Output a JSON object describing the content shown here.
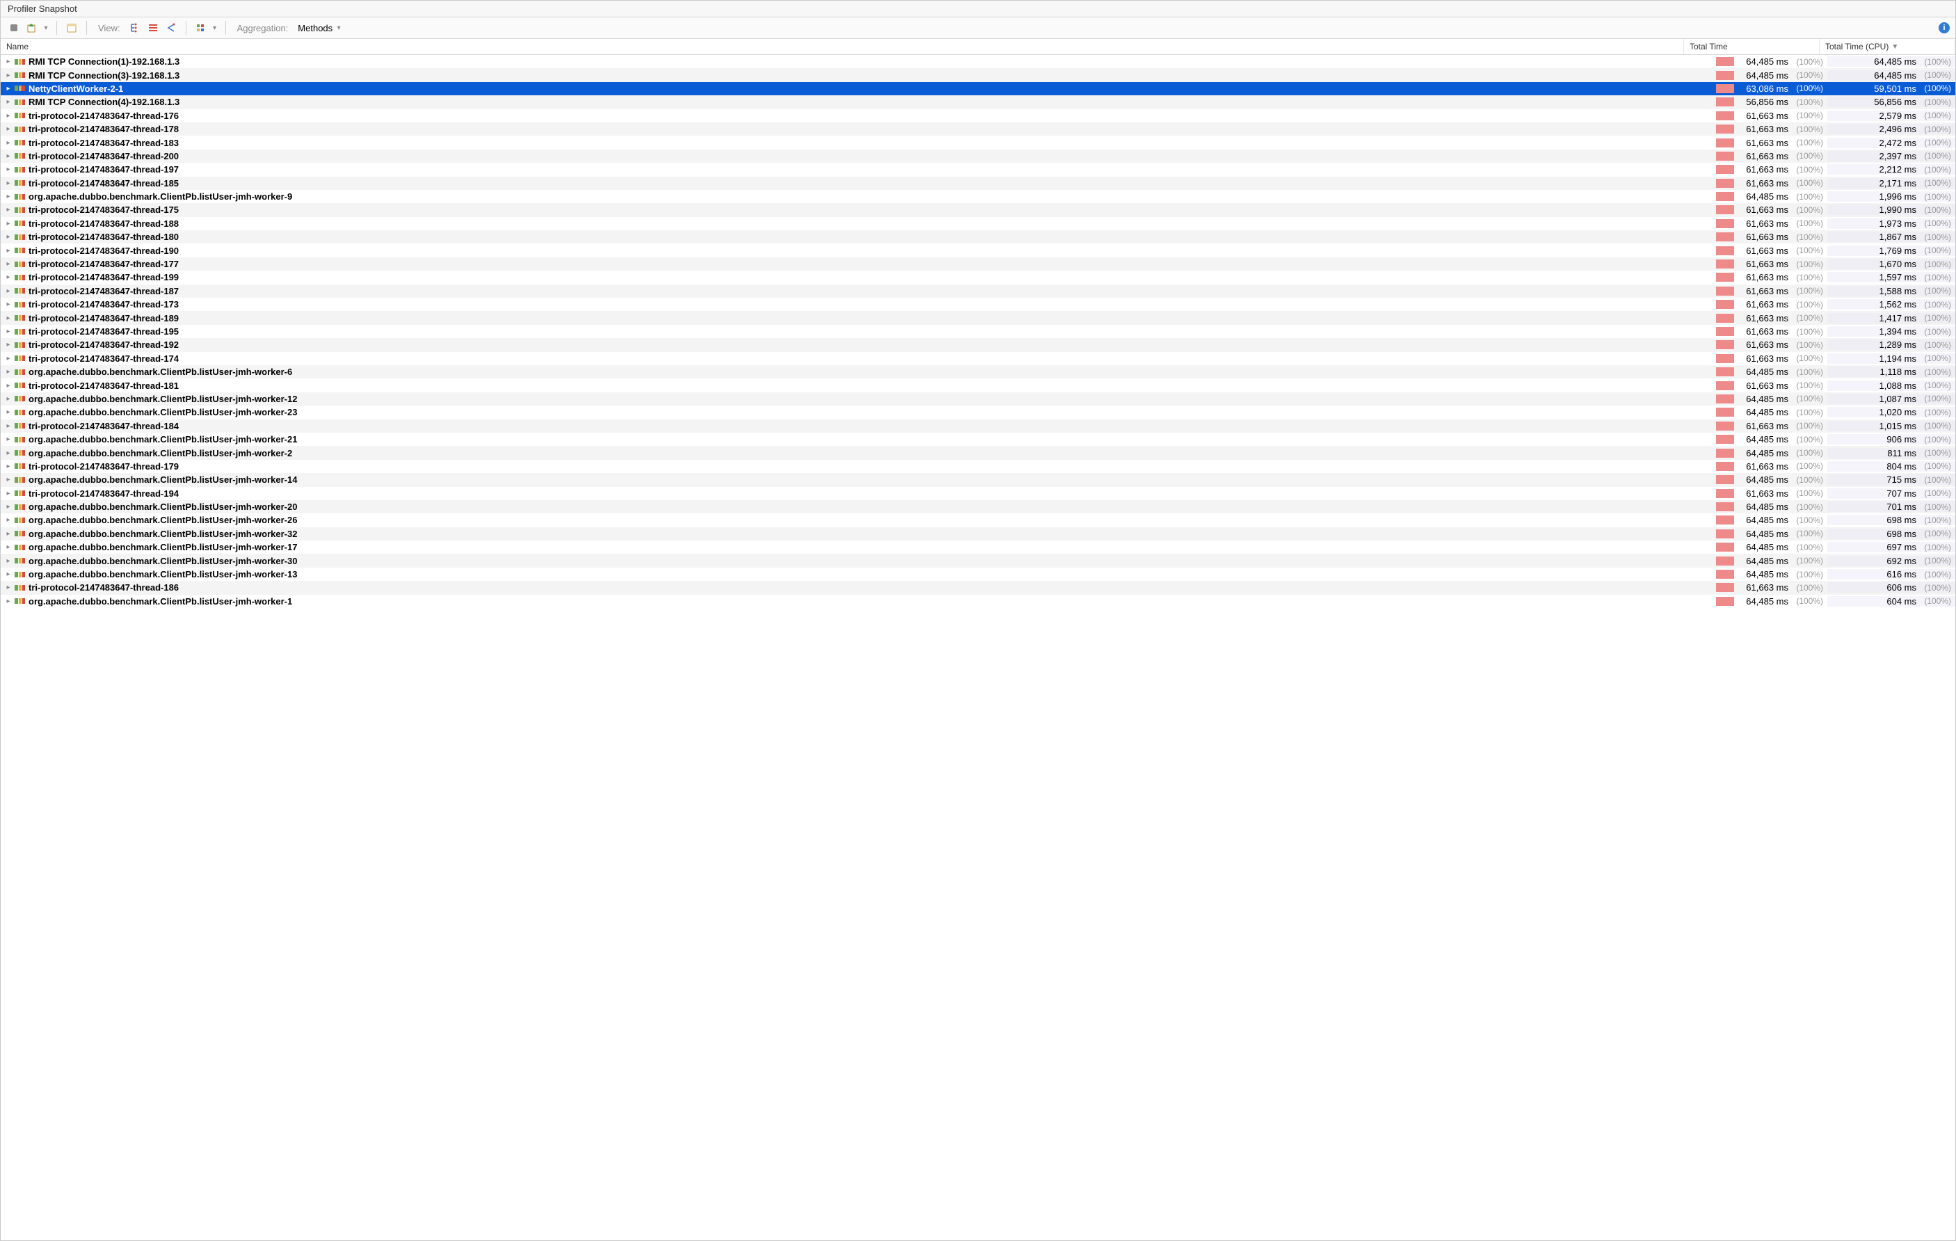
{
  "title": "Profiler Snapshot",
  "toolbar": {
    "view_label": "View:",
    "aggregation_label": "Aggregation:",
    "aggregation_value": "Methods"
  },
  "columns": {
    "name": "Name",
    "total_time": "Total Time",
    "total_time_cpu": "Total Time (CPU)"
  },
  "rows": [
    {
      "name": "RMI TCP Connection(1)-192.168.1.3",
      "tt": "64,485 ms",
      "ttp": "(100%)",
      "cpu": "64,485 ms",
      "cpup": "(100%)",
      "sel": false,
      "icon": "run"
    },
    {
      "name": "RMI TCP Connection(3)-192.168.1.3",
      "tt": "64,485 ms",
      "ttp": "(100%)",
      "cpu": "64,485 ms",
      "cpup": "(100%)",
      "sel": false,
      "icon": "run"
    },
    {
      "name": "NettyClientWorker-2-1",
      "tt": "63,086 ms",
      "ttp": "(100%)",
      "cpu": "59,501 ms",
      "cpup": "(100%)",
      "sel": true,
      "icon": "run"
    },
    {
      "name": "RMI TCP Connection(4)-192.168.1.3",
      "tt": "56,856 ms",
      "ttp": "(100%)",
      "cpu": "56,856 ms",
      "cpup": "(100%)",
      "sel": false,
      "icon": "run"
    },
    {
      "name": "tri-protocol-2147483647-thread-176",
      "tt": "61,663 ms",
      "ttp": "(100%)",
      "cpu": "2,579 ms",
      "cpup": "(100%)",
      "sel": false,
      "icon": "wait"
    },
    {
      "name": "tri-protocol-2147483647-thread-178",
      "tt": "61,663 ms",
      "ttp": "(100%)",
      "cpu": "2,496 ms",
      "cpup": "(100%)",
      "sel": false,
      "icon": "wait"
    },
    {
      "name": "tri-protocol-2147483647-thread-183",
      "tt": "61,663 ms",
      "ttp": "(100%)",
      "cpu": "2,472 ms",
      "cpup": "(100%)",
      "sel": false,
      "icon": "wait"
    },
    {
      "name": "tri-protocol-2147483647-thread-200",
      "tt": "61,663 ms",
      "ttp": "(100%)",
      "cpu": "2,397 ms",
      "cpup": "(100%)",
      "sel": false,
      "icon": "wait"
    },
    {
      "name": "tri-protocol-2147483647-thread-197",
      "tt": "61,663 ms",
      "ttp": "(100%)",
      "cpu": "2,212 ms",
      "cpup": "(100%)",
      "sel": false,
      "icon": "wait"
    },
    {
      "name": "tri-protocol-2147483647-thread-185",
      "tt": "61,663 ms",
      "ttp": "(100%)",
      "cpu": "2,171 ms",
      "cpup": "(100%)",
      "sel": false,
      "icon": "wait"
    },
    {
      "name": "org.apache.dubbo.benchmark.ClientPb.listUser-jmh-worker-9",
      "tt": "64,485 ms",
      "ttp": "(100%)",
      "cpu": "1,996 ms",
      "cpup": "(100%)",
      "sel": false,
      "icon": "wait"
    },
    {
      "name": "tri-protocol-2147483647-thread-175",
      "tt": "61,663 ms",
      "ttp": "(100%)",
      "cpu": "1,990 ms",
      "cpup": "(100%)",
      "sel": false,
      "icon": "wait"
    },
    {
      "name": "tri-protocol-2147483647-thread-188",
      "tt": "61,663 ms",
      "ttp": "(100%)",
      "cpu": "1,973 ms",
      "cpup": "(100%)",
      "sel": false,
      "icon": "wait"
    },
    {
      "name": "tri-protocol-2147483647-thread-180",
      "tt": "61,663 ms",
      "ttp": "(100%)",
      "cpu": "1,867 ms",
      "cpup": "(100%)",
      "sel": false,
      "icon": "wait"
    },
    {
      "name": "tri-protocol-2147483647-thread-190",
      "tt": "61,663 ms",
      "ttp": "(100%)",
      "cpu": "1,769 ms",
      "cpup": "(100%)",
      "sel": false,
      "icon": "wait"
    },
    {
      "name": "tri-protocol-2147483647-thread-177",
      "tt": "61,663 ms",
      "ttp": "(100%)",
      "cpu": "1,670 ms",
      "cpup": "(100%)",
      "sel": false,
      "icon": "wait"
    },
    {
      "name": "tri-protocol-2147483647-thread-199",
      "tt": "61,663 ms",
      "ttp": "(100%)",
      "cpu": "1,597 ms",
      "cpup": "(100%)",
      "sel": false,
      "icon": "wait"
    },
    {
      "name": "tri-protocol-2147483647-thread-187",
      "tt": "61,663 ms",
      "ttp": "(100%)",
      "cpu": "1,588 ms",
      "cpup": "(100%)",
      "sel": false,
      "icon": "wait"
    },
    {
      "name": "tri-protocol-2147483647-thread-173",
      "tt": "61,663 ms",
      "ttp": "(100%)",
      "cpu": "1,562 ms",
      "cpup": "(100%)",
      "sel": false,
      "icon": "wait"
    },
    {
      "name": "tri-protocol-2147483647-thread-189",
      "tt": "61,663 ms",
      "ttp": "(100%)",
      "cpu": "1,417 ms",
      "cpup": "(100%)",
      "sel": false,
      "icon": "wait"
    },
    {
      "name": "tri-protocol-2147483647-thread-195",
      "tt": "61,663 ms",
      "ttp": "(100%)",
      "cpu": "1,394 ms",
      "cpup": "(100%)",
      "sel": false,
      "icon": "wait"
    },
    {
      "name": "tri-protocol-2147483647-thread-192",
      "tt": "61,663 ms",
      "ttp": "(100%)",
      "cpu": "1,289 ms",
      "cpup": "(100%)",
      "sel": false,
      "icon": "wait"
    },
    {
      "name": "tri-protocol-2147483647-thread-174",
      "tt": "61,663 ms",
      "ttp": "(100%)",
      "cpu": "1,194 ms",
      "cpup": "(100%)",
      "sel": false,
      "icon": "wait"
    },
    {
      "name": "org.apache.dubbo.benchmark.ClientPb.listUser-jmh-worker-6",
      "tt": "64,485 ms",
      "ttp": "(100%)",
      "cpu": "1,118 ms",
      "cpup": "(100%)",
      "sel": false,
      "icon": "wait"
    },
    {
      "name": "tri-protocol-2147483647-thread-181",
      "tt": "61,663 ms",
      "ttp": "(100%)",
      "cpu": "1,088 ms",
      "cpup": "(100%)",
      "sel": false,
      "icon": "wait"
    },
    {
      "name": "org.apache.dubbo.benchmark.ClientPb.listUser-jmh-worker-12",
      "tt": "64,485 ms",
      "ttp": "(100%)",
      "cpu": "1,087 ms",
      "cpup": "(100%)",
      "sel": false,
      "icon": "wait"
    },
    {
      "name": "org.apache.dubbo.benchmark.ClientPb.listUser-jmh-worker-23",
      "tt": "64,485 ms",
      "ttp": "(100%)",
      "cpu": "1,020 ms",
      "cpup": "(100%)",
      "sel": false,
      "icon": "wait"
    },
    {
      "name": "tri-protocol-2147483647-thread-184",
      "tt": "61,663 ms",
      "ttp": "(100%)",
      "cpu": "1,015 ms",
      "cpup": "(100%)",
      "sel": false,
      "icon": "wait"
    },
    {
      "name": "org.apache.dubbo.benchmark.ClientPb.listUser-jmh-worker-21",
      "tt": "64,485 ms",
      "ttp": "(100%)",
      "cpu": "906 ms",
      "cpup": "(100%)",
      "sel": false,
      "icon": "wait"
    },
    {
      "name": "org.apache.dubbo.benchmark.ClientPb.listUser-jmh-worker-2",
      "tt": "64,485 ms",
      "ttp": "(100%)",
      "cpu": "811 ms",
      "cpup": "(100%)",
      "sel": false,
      "icon": "wait"
    },
    {
      "name": "tri-protocol-2147483647-thread-179",
      "tt": "61,663 ms",
      "ttp": "(100%)",
      "cpu": "804 ms",
      "cpup": "(100%)",
      "sel": false,
      "icon": "wait"
    },
    {
      "name": "org.apache.dubbo.benchmark.ClientPb.listUser-jmh-worker-14",
      "tt": "64,485 ms",
      "ttp": "(100%)",
      "cpu": "715 ms",
      "cpup": "(100%)",
      "sel": false,
      "icon": "wait"
    },
    {
      "name": "tri-protocol-2147483647-thread-194",
      "tt": "61,663 ms",
      "ttp": "(100%)",
      "cpu": "707 ms",
      "cpup": "(100%)",
      "sel": false,
      "icon": "wait"
    },
    {
      "name": "org.apache.dubbo.benchmark.ClientPb.listUser-jmh-worker-20",
      "tt": "64,485 ms",
      "ttp": "(100%)",
      "cpu": "701 ms",
      "cpup": "(100%)",
      "sel": false,
      "icon": "wait"
    },
    {
      "name": "org.apache.dubbo.benchmark.ClientPb.listUser-jmh-worker-26",
      "tt": "64,485 ms",
      "ttp": "(100%)",
      "cpu": "698 ms",
      "cpup": "(100%)",
      "sel": false,
      "icon": "wait"
    },
    {
      "name": "org.apache.dubbo.benchmark.ClientPb.listUser-jmh-worker-32",
      "tt": "64,485 ms",
      "ttp": "(100%)",
      "cpu": "698 ms",
      "cpup": "(100%)",
      "sel": false,
      "icon": "wait"
    },
    {
      "name": "org.apache.dubbo.benchmark.ClientPb.listUser-jmh-worker-17",
      "tt": "64,485 ms",
      "ttp": "(100%)",
      "cpu": "697 ms",
      "cpup": "(100%)",
      "sel": false,
      "icon": "wait"
    },
    {
      "name": "org.apache.dubbo.benchmark.ClientPb.listUser-jmh-worker-30",
      "tt": "64,485 ms",
      "ttp": "(100%)",
      "cpu": "692 ms",
      "cpup": "(100%)",
      "sel": false,
      "icon": "wait"
    },
    {
      "name": "org.apache.dubbo.benchmark.ClientPb.listUser-jmh-worker-13",
      "tt": "64,485 ms",
      "ttp": "(100%)",
      "cpu": "616 ms",
      "cpup": "(100%)",
      "sel": false,
      "icon": "wait"
    },
    {
      "name": "tri-protocol-2147483647-thread-186",
      "tt": "61,663 ms",
      "ttp": "(100%)",
      "cpu": "606 ms",
      "cpup": "(100%)",
      "sel": false,
      "icon": "wait"
    },
    {
      "name": "org.apache.dubbo.benchmark.ClientPb.listUser-jmh-worker-1",
      "tt": "64,485 ms",
      "ttp": "(100%)",
      "cpu": "604 ms",
      "cpup": "(100%)",
      "sel": false,
      "icon": "wait"
    }
  ]
}
